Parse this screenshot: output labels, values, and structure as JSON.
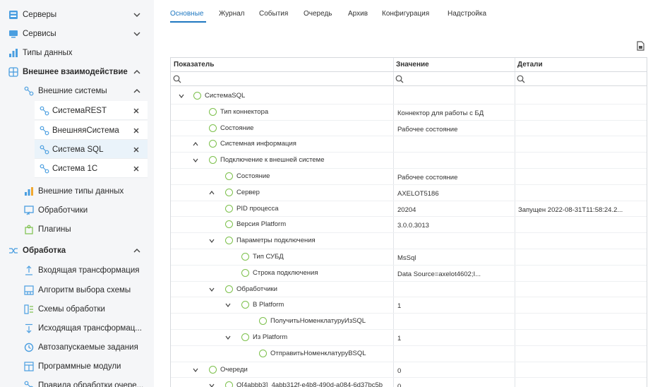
{
  "sidebar": {
    "items": [
      {
        "label": "Серверы",
        "icon": "server-icon"
      },
      {
        "label": "Сервисы",
        "icon": "monitor-icon"
      },
      {
        "label": "Типы данных",
        "icon": "data-types-icon"
      },
      {
        "label": "Внешнее взаимодействие",
        "icon": "external-icon"
      },
      {
        "label": "Внешние системы",
        "icon": "link-icon"
      },
      {
        "label": "СистемаREST",
        "icon": "link-icon"
      },
      {
        "label": "ВнешняяСистема",
        "icon": "link-icon"
      },
      {
        "label": "Система SQL",
        "icon": "link-icon"
      },
      {
        "label": "Система 1С",
        "icon": "link-icon"
      },
      {
        "label": "Внешние типы данных",
        "icon": "external-types-icon"
      },
      {
        "label": "Обработчики",
        "icon": "handler-icon"
      },
      {
        "label": "Плагины",
        "icon": "plugin-icon"
      },
      {
        "label": "Обработка",
        "icon": "processing-icon"
      },
      {
        "label": "Входящая трансформация",
        "icon": "incoming-icon"
      },
      {
        "label": "Алгоритм выбора схемы",
        "icon": "algorithm-icon"
      },
      {
        "label": "Схемы обработки",
        "icon": "schema-icon"
      },
      {
        "label": "Исходящая трансформац...",
        "icon": "outgoing-icon"
      },
      {
        "label": "Автозапускаемые задания",
        "icon": "autorun-icon"
      },
      {
        "label": "Программные модули",
        "icon": "module-icon"
      },
      {
        "label": "Правила обработки очере...",
        "icon": "rules-icon"
      }
    ]
  },
  "tabs": [
    "Основные",
    "Журнал",
    "События",
    "Очередь",
    "Архив",
    "Конфигурация",
    "Надстройка"
  ],
  "grid": {
    "headers": [
      "Показатель",
      "Значение",
      "Детали"
    ],
    "rows": [
      {
        "name": "СистемаSQL",
        "value": "",
        "details": ""
      },
      {
        "name": "Тип коннектора",
        "value": "Коннектор для работы с БД",
        "details": ""
      },
      {
        "name": "Состояние",
        "value": "Рабочее состояние",
        "details": ""
      },
      {
        "name": "Системная информация",
        "value": "",
        "details": ""
      },
      {
        "name": "Подключение к внешней системе",
        "value": "",
        "details": ""
      },
      {
        "name": "Состояние",
        "value": "Рабочее состояние",
        "details": ""
      },
      {
        "name": "Сервер",
        "value": "AXELOT5186",
        "details": ""
      },
      {
        "name": "PID процесса",
        "value": "20204",
        "details": "Запущен 2022-08-31T11:58:24.2..."
      },
      {
        "name": "Версия Platform",
        "value": "3.0.0.3013",
        "details": ""
      },
      {
        "name": "Параметры подключения",
        "value": "",
        "details": ""
      },
      {
        "name": "Тип СУБД",
        "value": "MsSql",
        "details": ""
      },
      {
        "name": "Строка подключения",
        "value": "Data Source=axelot4602;I...",
        "details": ""
      },
      {
        "name": "Обработчики",
        "value": "",
        "details": ""
      },
      {
        "name": "В Platform",
        "value": "1",
        "details": ""
      },
      {
        "name": "ПолучитьНоменклатуруИзSQL",
        "value": "",
        "details": ""
      },
      {
        "name": "Из Platform",
        "value": "1",
        "details": ""
      },
      {
        "name": "ОтправитьНоменклатуруВSQL",
        "value": "",
        "details": ""
      },
      {
        "name": "Очереди",
        "value": "0",
        "details": ""
      },
      {
        "name": "Q[4abbb3]_4abb312f-e4b8-490d-a084-6d37bc5b",
        "value": "0",
        "details": ""
      }
    ]
  },
  "colors": {
    "accent": "#1f78c1",
    "status_ok": "#7cc04b",
    "sidebar_bg": "#f5f6f8"
  }
}
